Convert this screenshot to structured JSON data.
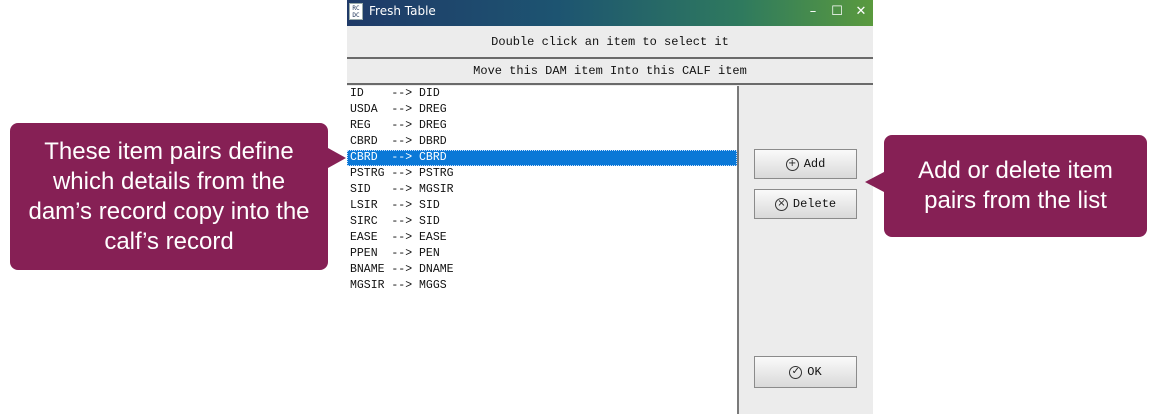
{
  "window": {
    "title": "Fresh Table",
    "icon_text": "RC\nDC",
    "controls": {
      "minimize": "–",
      "maximize": "☐",
      "close": "✕"
    }
  },
  "header1": "Double click an item to select it",
  "header2": "Move this DAM item Into this CALF item",
  "list": {
    "items": [
      "ID    --> DID",
      "USDA  --> DREG",
      "REG   --> DREG",
      "CBRD  --> DBRD",
      "CBRD  --> CBRD",
      "PSTRG --> PSTRG",
      "SID   --> MGSIR",
      "LSIR  --> SID",
      "SIRC  --> SID",
      "EASE  --> EASE",
      "PPEN  --> PEN",
      "BNAME --> DNAME",
      "MGSIR --> MGGS"
    ],
    "selected_index": 4
  },
  "buttons": {
    "add": {
      "label": "Add",
      "icon": "plus-circle-icon",
      "glyph": "+"
    },
    "delete": {
      "label": "Delete",
      "icon": "x-circle-icon",
      "glyph": "×"
    },
    "ok": {
      "label": "OK",
      "icon": "check-circle-icon",
      "glyph": "✓"
    }
  },
  "callouts": {
    "left": "These item pairs define which details from the dam’s record copy into the calf’s record",
    "right": "Add or delete item pairs from the list"
  },
  "colors": {
    "callout": "#862055",
    "selection": "#0a78d7"
  }
}
